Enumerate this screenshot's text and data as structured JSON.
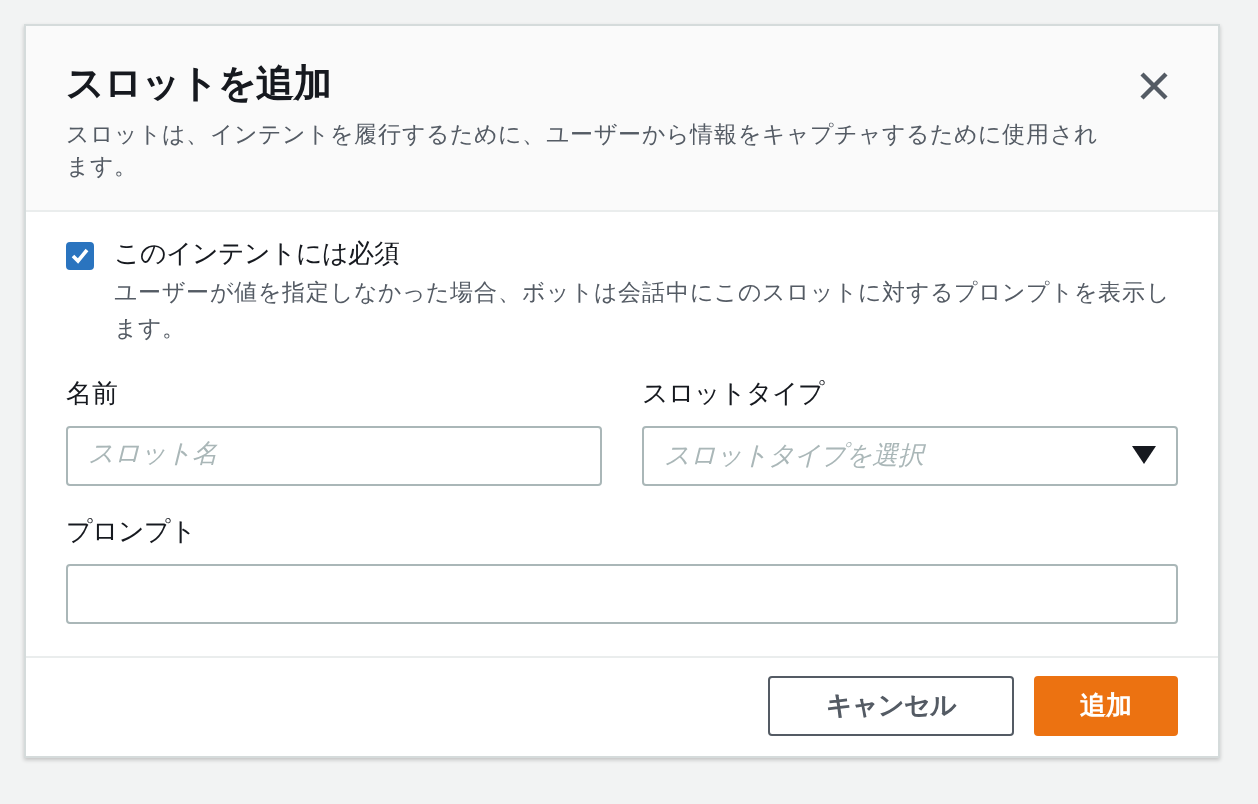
{
  "dialog": {
    "title": "スロットを追加",
    "description": "スロットは、インテントを履行するために、ユーザーから情報をキャプチャするために使用されます。"
  },
  "required": {
    "label": "このインテントには必須",
    "description": "ユーザーが値を指定しなかった場合、ボットは会話中にこのスロットに対するプロンプトを表示します。",
    "checked": true
  },
  "fields": [
    {
      "kind": "text",
      "label": "名前",
      "placeholder": "スロット名"
    },
    {
      "kind": "select",
      "label": "スロットタイプ",
      "placeholder": "スロットタイプを選択"
    },
    {
      "kind": "text",
      "label": "プロンプト"
    }
  ],
  "buttons": [
    {
      "kind": "secondary",
      "label": "キャンセル"
    },
    {
      "kind": "primary",
      "label": "追加"
    }
  ]
}
